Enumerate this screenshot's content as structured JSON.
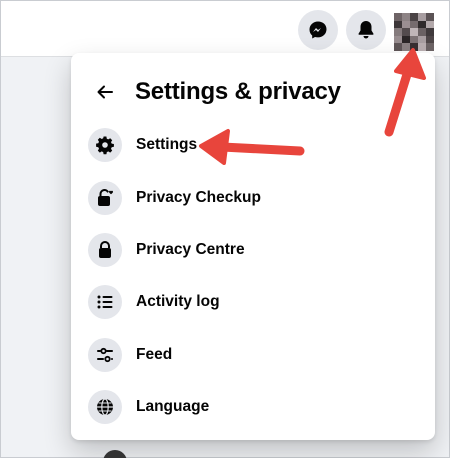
{
  "header": {
    "messenger_icon": "messenger-icon",
    "notifications_icon": "bell-icon"
  },
  "panel": {
    "title": "Settings & privacy",
    "back_icon": "arrow-left-icon"
  },
  "menu": {
    "items": [
      {
        "label": "Settings",
        "icon": "gear-icon"
      },
      {
        "label": "Privacy Checkup",
        "icon": "lock-heart-icon"
      },
      {
        "label": "Privacy Centre",
        "icon": "lock-icon"
      },
      {
        "label": "Activity log",
        "icon": "list-icon"
      },
      {
        "label": "Feed",
        "icon": "sliders-icon"
      },
      {
        "label": "Language",
        "icon": "globe-icon"
      }
    ]
  },
  "colors": {
    "annotation_arrow": "#e8453c",
    "icon_bg": "#e4e6eb",
    "text": "#050505",
    "page_bg": "#f0f2f5"
  }
}
